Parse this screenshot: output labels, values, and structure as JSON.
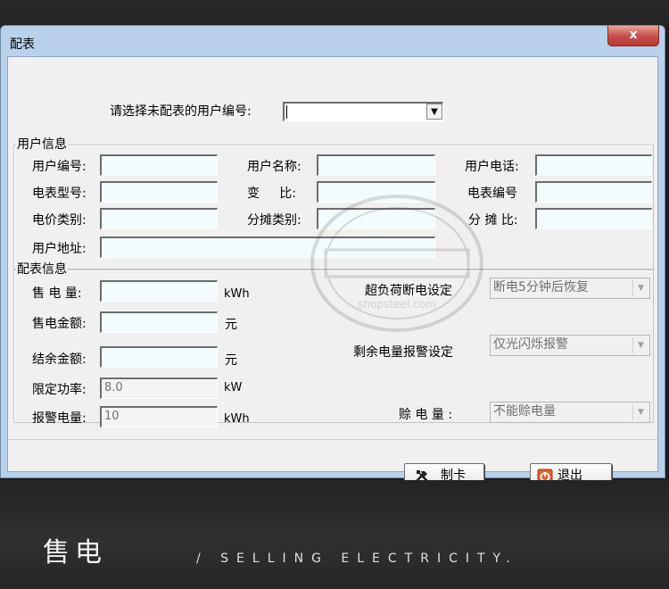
{
  "window": {
    "title": "配表",
    "close_glyph": "x"
  },
  "selector": {
    "label": "请选择未配表的用户编号:",
    "value": ""
  },
  "user_info": {
    "group_title": "用户信息",
    "user_no_label": "用户编号:",
    "user_name_label": "用户名称:",
    "user_phone_label": "用户电话:",
    "meter_model_label": "电表型号:",
    "ratio_label": "变     比:",
    "meter_no_label": "电表编号",
    "price_type_label": "电价类别:",
    "share_type_label": "分摊类别:",
    "share_ratio_label": "分 摊 比:",
    "address_label": "用户地址:"
  },
  "meter_info": {
    "group_title": "配表信息",
    "sale_power_label": "售 电 量:",
    "sale_power_unit": "kWh",
    "sale_amount_label": "售电金额:",
    "sale_amount_unit": "元",
    "balance_label": "结余金额:",
    "balance_unit": "元",
    "power_limit_label": "限定功率:",
    "power_limit_value": "8.0",
    "power_limit_unit": "kW",
    "alarm_power_label": "报警电量:",
    "alarm_power_value": "10",
    "alarm_power_unit": "kWh",
    "overload_label": "超负荷断电设定",
    "overload_value": "断电5分钟后恢复",
    "remaining_alarm_label": "剩余电量报警设定",
    "remaining_alarm_value": "仅光闪烁报警",
    "credit_label": "赊 电 量 :",
    "credit_value": "不能赊电量"
  },
  "buttons": {
    "make_card": "制卡",
    "exit": "退出"
  },
  "watermark": {
    "text": "shopsteel.com"
  },
  "banner": {
    "title": "售电",
    "subtitle": "/ SELLING ELECTRICITY."
  },
  "colors": {
    "window_frame": "#b9d1ea",
    "client_bg": "#f0f0f0",
    "field_bg": "#f3fbfd",
    "close_red": "#c75050"
  }
}
